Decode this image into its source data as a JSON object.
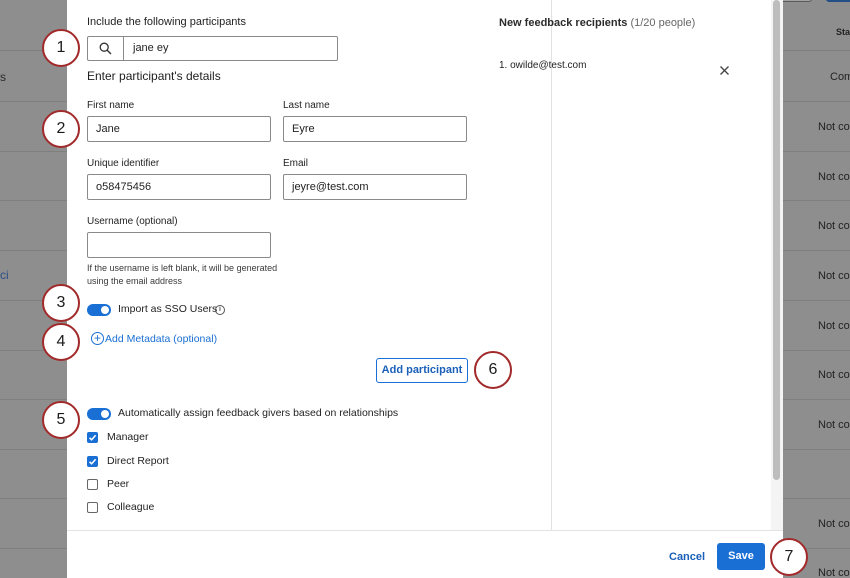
{
  "background": {
    "left_items": [
      "s",
      "ci"
    ],
    "status_header": "Sta",
    "status_first": "Com",
    "status_values": [
      "Not com",
      "Not com",
      "Not com",
      "Not com",
      "Not com",
      "Not com",
      "Not com",
      "Not com",
      "Not com"
    ]
  },
  "form": {
    "include_label": "Include the following participants",
    "search_value": "jane ey",
    "details_label": "Enter participant's details",
    "first_name_label": "First name",
    "first_name_value": "Jane",
    "last_name_label": "Last name",
    "last_name_value": "Eyre",
    "uid_label": "Unique identifier",
    "uid_value": "o58475456",
    "email_label": "Email",
    "email_value": "jeyre@test.com",
    "username_label": "Username (optional)",
    "username_value": "",
    "username_hint": "If the username is left blank, it will be generated using the email address",
    "sso_label": "Import as SSO Users",
    "info_glyph": "i",
    "plus_glyph": "+",
    "metadata_link": "Add Metadata (optional)",
    "add_participant": "Add participant",
    "auto_assign_label": "Automatically assign feedback givers based on relationships",
    "relationships": [
      {
        "label": "Manager",
        "checked": true
      },
      {
        "label": "Direct Report",
        "checked": true
      },
      {
        "label": "Peer",
        "checked": false
      },
      {
        "label": "Colleague",
        "checked": false
      }
    ]
  },
  "recipients": {
    "heading": "New feedback recipients",
    "count": "(1/20 people)",
    "items": [
      "1. owilde@test.com"
    ]
  },
  "footer": {
    "cancel": "Cancel",
    "save": "Save"
  },
  "callouts": [
    "1",
    "2",
    "3",
    "4",
    "5",
    "6",
    "7"
  ],
  "colors": {
    "accent": "#1a6fd4",
    "callout_border": "#a2292a"
  }
}
